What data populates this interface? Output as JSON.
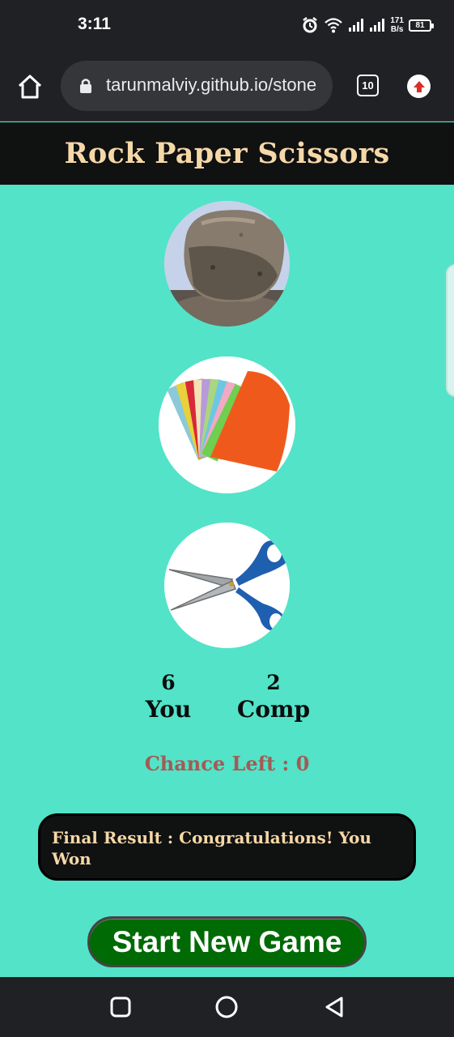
{
  "status_bar": {
    "time": "3:11",
    "net_speed_value": "171",
    "net_speed_unit": "B/s",
    "battery_level": "81"
  },
  "browser": {
    "url": "tarunmalviy.github.io/stone",
    "tab_count": "10"
  },
  "page": {
    "title": "Rock Paper Scissors",
    "choices": [
      "rock-image",
      "paper-image",
      "scissors-image"
    ],
    "scores": {
      "you_value": "6",
      "you_label": "You",
      "comp_value": "2",
      "comp_label": "Comp"
    },
    "chance_left": "Chance Left : 0",
    "final_result": "Final Result : Congratulations! You Won",
    "start_button_label": "Start New Game"
  },
  "colors": {
    "page_background": "#53e3c8",
    "header_background": "#101111",
    "title_color": "#f6d8a8",
    "chance_color": "#a45a55",
    "button_background": "#006a04"
  },
  "icons": {
    "home": "home-icon",
    "lock": "lock-icon",
    "tabs": "tabs-icon",
    "update": "update-arrow-icon",
    "alarm": "alarm-icon",
    "wifi": "wifi-icon",
    "signal": "signal-icon",
    "battery": "battery-icon",
    "nav_recent": "square-icon",
    "nav_home": "circle-icon",
    "nav_back": "triangle-back-icon"
  }
}
